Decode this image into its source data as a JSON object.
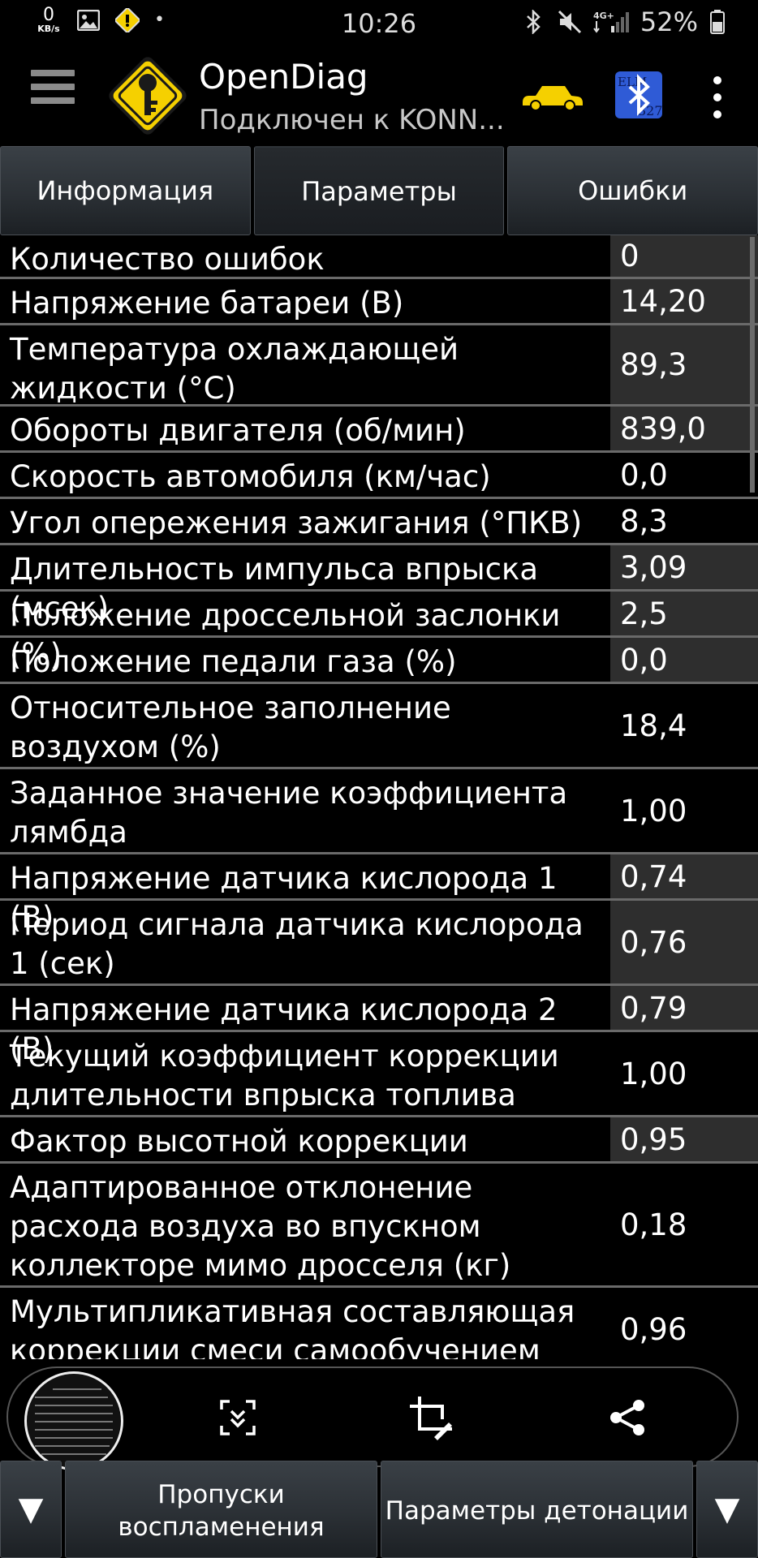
{
  "status_bar": {
    "net_speed_value": "0",
    "net_speed_unit": "KB/s",
    "time": "10:26",
    "battery_percent": "52%",
    "network_label": "4G+",
    "icons": [
      "gallery-icon",
      "app-notification-icon",
      "bluetooth-icon",
      "mute-icon",
      "signal-icon",
      "battery-icon"
    ]
  },
  "app_bar": {
    "title": "OpenDiag",
    "subtitle": "Подключен к KONN...",
    "logo_color": "#f5d000",
    "car_color": "#f5d000",
    "bt_badge_color": "#2f5bd6"
  },
  "tabs": [
    {
      "label": "Информация",
      "active": false
    },
    {
      "label": "Параметры",
      "active": true
    },
    {
      "label": "Ошибки",
      "active": false
    }
  ],
  "parameters": [
    {
      "name": "Количество ошибок",
      "value": "0"
    },
    {
      "name": "Напряжение батареи (В)",
      "value": "14,20"
    },
    {
      "name": "Температура охлаждающей жидкости (°С)",
      "value": "89,3"
    },
    {
      "name": "Обороты двигателя (об/мин)",
      "value": "839,0"
    },
    {
      "name": "Скорость автомобиля (км/час)",
      "value": "0,0"
    },
    {
      "name": "Угол опережения зажигания (°ПКВ)",
      "value": "8,3"
    },
    {
      "name": "Длительность импульса впрыска (мсек)",
      "value": "3,09"
    },
    {
      "name": "Положение дроссельной заслонки (%)",
      "value": "2,5"
    },
    {
      "name": "Положение педали газа (%)",
      "value": "0,0"
    },
    {
      "name": "Относительное заполнение воздухом (%)",
      "value": "18,4"
    },
    {
      "name": "Заданное значение коэффициента лямбда",
      "value": "1,00"
    },
    {
      "name": "Напряжение датчика кислорода 1 (В)",
      "value": "0,74"
    },
    {
      "name": "Период сигнала датчика кислорода 1 (сек)",
      "value": "0,76"
    },
    {
      "name": "Напряжение датчика кислорода 2 (В)",
      "value": "0,79"
    },
    {
      "name": "Текущий коэффициент коррекции длительности впрыска топлива",
      "value": "1,00"
    },
    {
      "name": "Фактор высотной коррекции",
      "value": "0,95"
    },
    {
      "name": "Адаптированное отклонение расхода воздуха во впускном коллекторе мимо дросселя (кг)",
      "value": "0,18"
    },
    {
      "name": "Мультипликативная составляющая коррекции смеси самообучением",
      "value": "0,96"
    }
  ],
  "screenshot_toolbar": {
    "actions": [
      "scroll-capture-icon",
      "crop-edit-icon",
      "share-icon"
    ]
  },
  "bottom_nav": {
    "left_arrow": "▼",
    "right_arrow": "▼",
    "button1": "Пропуски воспламенения",
    "button2": "Параметры детонации"
  }
}
